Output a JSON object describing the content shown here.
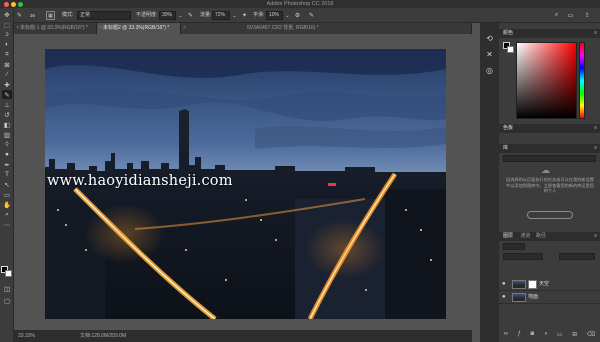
{
  "window": {
    "title": "Adobe Photoshop CC 2018",
    "traffic_colors": [
      "#ff5f57",
      "#febc2e",
      "#28c840"
    ]
  },
  "options_bar": {
    "brush_size": "36",
    "mode_label": "模式:",
    "mode_value": "正常",
    "opacity_label": "不透明度:",
    "opacity_value": "30%",
    "flow_label": "流量:",
    "flow_value": "72%",
    "smoothing_label": "平滑:",
    "smoothing_value": "10%"
  },
  "tabs": [
    {
      "label": "未标题-1 @ 33.3%(RGB/16*) *",
      "active": false
    },
    {
      "label": "未标题2 @ 33.3%(RGB/16*) *",
      "active": true
    },
    {
      "label": "5V3A0467.CR2 背景, RGB/16) *",
      "active": false
    }
  ],
  "canvas": {
    "watermark": "www.haoyidiansheji.com"
  },
  "status_bar": {
    "zoom": "33.33%",
    "doc_info": "文档:128.0M/259.0M"
  },
  "panels": {
    "color_tab": "颜色",
    "swatches_tab": "色板",
    "library_tab": "库",
    "library_message": "因选择的从后面执行的任务或可以在我的新设置中以添加到图库中。立即查看您的新的库还是您的个人",
    "layers_tab": "图层",
    "channels_tab": "通道",
    "paths_tab": "路径",
    "layers": [
      {
        "name": "天空",
        "selected": false
      },
      {
        "name": "地面",
        "selected": false
      }
    ]
  }
}
